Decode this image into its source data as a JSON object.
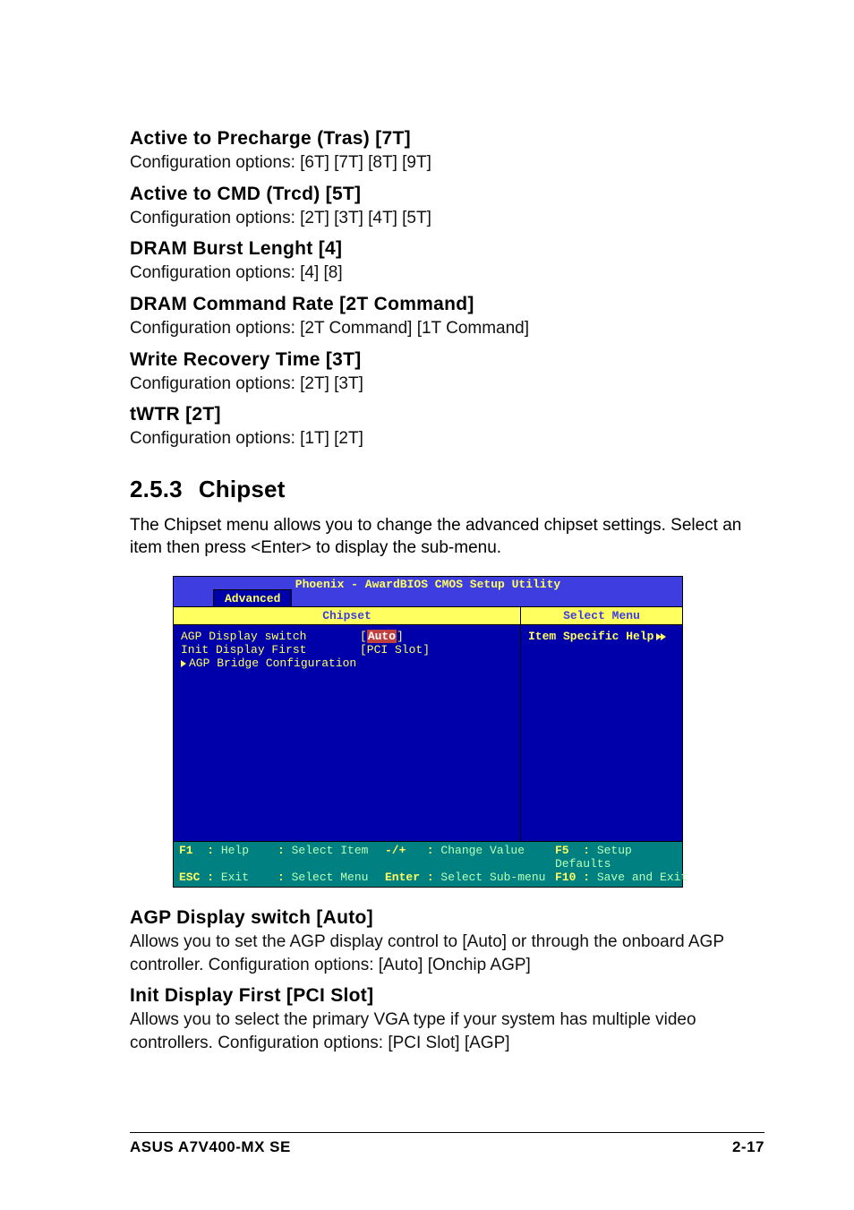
{
  "sections": [
    {
      "title": "Active to Precharge (Tras) [7T]",
      "body": "Configuration options: [6T] [7T] [8T] [9T]"
    },
    {
      "title": "Active to CMD (Trcd) [5T]",
      "body": "Configuration options: [2T] [3T] [4T] [5T]"
    },
    {
      "title": "DRAM Burst Lenght [4]",
      "body": "Configuration options: [4] [8]"
    },
    {
      "title": "DRAM Command Rate [2T Command]",
      "body": "Configuration options: [2T Command] [1T Command]"
    },
    {
      "title": "Write Recovery Time [3T]",
      "body": "Configuration options: [2T] [3T]"
    },
    {
      "title": "tWTR [2T]",
      "body": "Configuration options: [1T] [2T]"
    }
  ],
  "chipset": {
    "num": "2.5.3",
    "title": "Chipset",
    "intro": "The Chipset menu allows you to change the advanced chipset settings. Select an item then press <Enter> to display the sub-menu."
  },
  "bios": {
    "title": "Phoenix - AwardBIOS CMOS Setup Utility",
    "tab": "Advanced",
    "left_title": "Chipset",
    "right_title": "Select Menu",
    "help_text": "Item Specific Help",
    "items": [
      {
        "label": "AGP Display switch",
        "value": "Auto",
        "highlight": true,
        "pointer": false
      },
      {
        "label": "Init Display First",
        "value": "[PCI Slot]",
        "highlight": false,
        "pointer": false
      },
      {
        "label": "AGP Bridge Configuration",
        "value": "",
        "highlight": false,
        "pointer": true
      }
    ],
    "keys": [
      {
        "k": "F1",
        "l": "Help"
      },
      {
        "k": "↑↓→←",
        "l": "Select Item"
      },
      {
        "k": "-/+",
        "l": "Change Value"
      },
      {
        "k": "F5",
        "l": "Setup Defaults"
      },
      {
        "k": "ESC",
        "l": "Exit"
      },
      {
        "k": "↑↓→←",
        "l": "Select Menu"
      },
      {
        "k": "Enter",
        "l": "Select Sub-menu"
      },
      {
        "k": "F10",
        "l": "Save and Exit"
      }
    ]
  },
  "after": [
    {
      "title": "AGP Display switch [Auto]",
      "body": "Allows you to set the AGP display control to [Auto] or through the onboard AGP controller. Configuration options: [Auto] [Onchip AGP]"
    },
    {
      "title": "Init Display First [PCI Slot]",
      "body": "Allows you to select the primary VGA type if your system has multiple video controllers. Configuration options: [PCI Slot] [AGP]"
    }
  ],
  "footer": {
    "left": "ASUS A7V400-MX SE",
    "right": "2-17"
  }
}
